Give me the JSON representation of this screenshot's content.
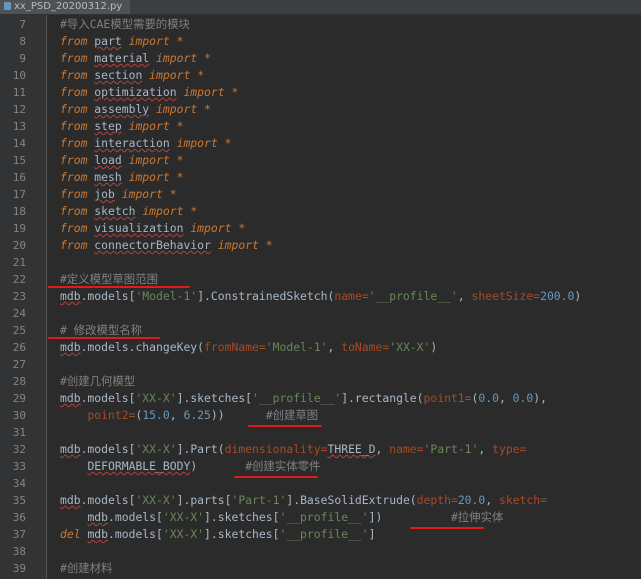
{
  "tab": {
    "filename": "xx_PSD_20200312.py"
  },
  "lines": [
    {
      "n": "7",
      "tokens": [
        {
          "t": "#导入CAE模型需要的模块",
          "c": "cmt"
        }
      ]
    },
    {
      "n": "8",
      "tokens": [
        {
          "t": "from",
          "c": "kw"
        },
        {
          "t": " "
        },
        {
          "t": "part",
          "c": "mod"
        },
        {
          "t": " "
        },
        {
          "t": "import",
          "c": "kw"
        },
        {
          "t": " "
        },
        {
          "t": "*",
          "c": "star"
        }
      ]
    },
    {
      "n": "9",
      "tokens": [
        {
          "t": "from",
          "c": "kw"
        },
        {
          "t": " "
        },
        {
          "t": "material",
          "c": "mod"
        },
        {
          "t": " "
        },
        {
          "t": "import",
          "c": "kw"
        },
        {
          "t": " "
        },
        {
          "t": "*",
          "c": "star"
        }
      ]
    },
    {
      "n": "10",
      "tokens": [
        {
          "t": "from",
          "c": "kw"
        },
        {
          "t": " "
        },
        {
          "t": "section",
          "c": "mod"
        },
        {
          "t": " "
        },
        {
          "t": "import",
          "c": "kw"
        },
        {
          "t": " "
        },
        {
          "t": "*",
          "c": "star"
        }
      ]
    },
    {
      "n": "11",
      "tokens": [
        {
          "t": "from",
          "c": "kw"
        },
        {
          "t": " "
        },
        {
          "t": "optimization",
          "c": "mod"
        },
        {
          "t": " "
        },
        {
          "t": "import",
          "c": "kw"
        },
        {
          "t": " "
        },
        {
          "t": "*",
          "c": "star"
        }
      ]
    },
    {
      "n": "12",
      "tokens": [
        {
          "t": "from",
          "c": "kw"
        },
        {
          "t": " "
        },
        {
          "t": "assembly",
          "c": "mod"
        },
        {
          "t": " "
        },
        {
          "t": "import",
          "c": "kw"
        },
        {
          "t": " "
        },
        {
          "t": "*",
          "c": "star"
        }
      ]
    },
    {
      "n": "13",
      "tokens": [
        {
          "t": "from",
          "c": "kw"
        },
        {
          "t": " "
        },
        {
          "t": "step",
          "c": "mod"
        },
        {
          "t": " "
        },
        {
          "t": "import",
          "c": "kw"
        },
        {
          "t": " "
        },
        {
          "t": "*",
          "c": "star"
        }
      ]
    },
    {
      "n": "14",
      "tokens": [
        {
          "t": "from",
          "c": "kw"
        },
        {
          "t": " "
        },
        {
          "t": "interaction",
          "c": "mod"
        },
        {
          "t": " "
        },
        {
          "t": "import",
          "c": "kw"
        },
        {
          "t": " "
        },
        {
          "t": "*",
          "c": "star"
        }
      ]
    },
    {
      "n": "15",
      "tokens": [
        {
          "t": "from",
          "c": "kw"
        },
        {
          "t": " "
        },
        {
          "t": "load",
          "c": "mod"
        },
        {
          "t": " "
        },
        {
          "t": "import",
          "c": "kw"
        },
        {
          "t": " "
        },
        {
          "t": "*",
          "c": "star"
        }
      ]
    },
    {
      "n": "16",
      "tokens": [
        {
          "t": "from",
          "c": "kw"
        },
        {
          "t": " "
        },
        {
          "t": "mesh",
          "c": "mod"
        },
        {
          "t": " "
        },
        {
          "t": "import",
          "c": "kw"
        },
        {
          "t": " "
        },
        {
          "t": "*",
          "c": "star"
        }
      ]
    },
    {
      "n": "17",
      "tokens": [
        {
          "t": "from",
          "c": "kw"
        },
        {
          "t": " "
        },
        {
          "t": "job",
          "c": "mod"
        },
        {
          "t": " "
        },
        {
          "t": "import",
          "c": "kw"
        },
        {
          "t": " "
        },
        {
          "t": "*",
          "c": "star"
        }
      ]
    },
    {
      "n": "18",
      "tokens": [
        {
          "t": "from",
          "c": "kw"
        },
        {
          "t": " "
        },
        {
          "t": "sketch",
          "c": "mod"
        },
        {
          "t": " "
        },
        {
          "t": "import",
          "c": "kw"
        },
        {
          "t": " "
        },
        {
          "t": "*",
          "c": "star"
        }
      ]
    },
    {
      "n": "19",
      "tokens": [
        {
          "t": "from",
          "c": "kw"
        },
        {
          "t": " "
        },
        {
          "t": "visualization",
          "c": "mod"
        },
        {
          "t": " "
        },
        {
          "t": "import",
          "c": "kw"
        },
        {
          "t": " "
        },
        {
          "t": "*",
          "c": "star"
        }
      ]
    },
    {
      "n": "20",
      "tokens": [
        {
          "t": "from",
          "c": "kw"
        },
        {
          "t": " "
        },
        {
          "t": "connectorBehavior",
          "c": "mod"
        },
        {
          "t": " "
        },
        {
          "t": "import",
          "c": "kw"
        },
        {
          "t": " "
        },
        {
          "t": "*",
          "c": "star"
        }
      ]
    },
    {
      "n": "21",
      "tokens": []
    },
    {
      "n": "22",
      "tokens": [
        {
          "t": "#定义模型草图范围",
          "c": "cmt"
        }
      ]
    },
    {
      "n": "23",
      "tokens": [
        {
          "t": "mdb",
          "c": "mod"
        },
        {
          "t": ".models[",
          "c": "ident"
        },
        {
          "t": "'Model-1'",
          "c": "str"
        },
        {
          "t": "].ConstrainedSketch(",
          "c": "func"
        },
        {
          "t": "name=",
          "c": "param"
        },
        {
          "t": "'__profile__'",
          "c": "str"
        },
        {
          "t": ", "
        },
        {
          "t": "sheetSize=",
          "c": "param"
        },
        {
          "t": "200.0",
          "c": "num"
        },
        {
          "t": ")"
        }
      ]
    },
    {
      "n": "24",
      "tokens": []
    },
    {
      "n": "25",
      "tokens": [
        {
          "t": "# 修改模型名称",
          "c": "cmt"
        }
      ]
    },
    {
      "n": "26",
      "tokens": [
        {
          "t": "mdb",
          "c": "mod"
        },
        {
          "t": ".models.changeKey(",
          "c": "func"
        },
        {
          "t": "fromName=",
          "c": "param"
        },
        {
          "t": "'Model-1'",
          "c": "str"
        },
        {
          "t": ", "
        },
        {
          "t": "toName=",
          "c": "param"
        },
        {
          "t": "'XX-X'",
          "c": "str"
        },
        {
          "t": ")"
        }
      ]
    },
    {
      "n": "27",
      "tokens": []
    },
    {
      "n": "28",
      "tokens": [
        {
          "t": "#创建几何模型",
          "c": "cmt"
        }
      ]
    },
    {
      "n": "29",
      "tokens": [
        {
          "t": "mdb",
          "c": "mod"
        },
        {
          "t": ".models[",
          "c": "ident"
        },
        {
          "t": "'XX-X'",
          "c": "str"
        },
        {
          "t": "].sketches[",
          "c": "ident"
        },
        {
          "t": "'__profile__'",
          "c": "str"
        },
        {
          "t": "].rectangle(",
          "c": "func"
        },
        {
          "t": "point1=",
          "c": "param"
        },
        {
          "t": "(",
          "c": "ident"
        },
        {
          "t": "0.0",
          "c": "num"
        },
        {
          "t": ", "
        },
        {
          "t": "0.0",
          "c": "num"
        },
        {
          "t": "),"
        }
      ]
    },
    {
      "n": "30",
      "tokens": [
        {
          "t": "    "
        },
        {
          "t": "point2=",
          "c": "param"
        },
        {
          "t": "(",
          "c": "ident"
        },
        {
          "t": "15.0",
          "c": "num"
        },
        {
          "t": ", "
        },
        {
          "t": "6.25",
          "c": "num"
        },
        {
          "t": "))"
        },
        {
          "t": "      "
        },
        {
          "t": "#创建草图",
          "c": "cmt"
        }
      ]
    },
    {
      "n": "31",
      "tokens": []
    },
    {
      "n": "32",
      "tokens": [
        {
          "t": "mdb",
          "c": "mod"
        },
        {
          "t": ".models[",
          "c": "ident"
        },
        {
          "t": "'XX-X'",
          "c": "str"
        },
        {
          "t": "].Part(",
          "c": "func"
        },
        {
          "t": "dimensionality=",
          "c": "param"
        },
        {
          "t": "THREE_D",
          "c": "mod"
        },
        {
          "t": ", "
        },
        {
          "t": "name=",
          "c": "param"
        },
        {
          "t": "'Part-1'",
          "c": "str"
        },
        {
          "t": ", "
        },
        {
          "t": "type=",
          "c": "param"
        }
      ]
    },
    {
      "n": "33",
      "tokens": [
        {
          "t": "    "
        },
        {
          "t": "DEFORMABLE_BODY",
          "c": "mod"
        },
        {
          "t": ")"
        },
        {
          "t": "       "
        },
        {
          "t": "#创建实体零件",
          "c": "cmt"
        }
      ]
    },
    {
      "n": "34",
      "tokens": []
    },
    {
      "n": "35",
      "tokens": [
        {
          "t": "mdb",
          "c": "mod"
        },
        {
          "t": ".models[",
          "c": "ident"
        },
        {
          "t": "'XX-X'",
          "c": "str"
        },
        {
          "t": "].parts[",
          "c": "ident"
        },
        {
          "t": "'Part-1'",
          "c": "str"
        },
        {
          "t": "].BaseSolidExtrude(",
          "c": "func"
        },
        {
          "t": "depth=",
          "c": "param"
        },
        {
          "t": "20.0",
          "c": "num"
        },
        {
          "t": ", "
        },
        {
          "t": "sketch=",
          "c": "param"
        }
      ]
    },
    {
      "n": "36",
      "tokens": [
        {
          "t": "    "
        },
        {
          "t": "mdb",
          "c": "mod"
        },
        {
          "t": ".models[",
          "c": "ident"
        },
        {
          "t": "'XX-X'",
          "c": "str"
        },
        {
          "t": "].sketches[",
          "c": "ident"
        },
        {
          "t": "'__profile__'",
          "c": "str"
        },
        {
          "t": "])"
        },
        {
          "t": "          "
        },
        {
          "t": "#拉伸实体",
          "c": "cmt"
        }
      ]
    },
    {
      "n": "37",
      "tokens": [
        {
          "t": "del",
          "c": "kw"
        },
        {
          "t": " "
        },
        {
          "t": "mdb",
          "c": "mod"
        },
        {
          "t": ".models[",
          "c": "ident"
        },
        {
          "t": "'XX-X'",
          "c": "str"
        },
        {
          "t": "].sketches[",
          "c": "ident"
        },
        {
          "t": "'__profile__'",
          "c": "str"
        },
        {
          "t": "]"
        }
      ]
    },
    {
      "n": "38",
      "tokens": []
    },
    {
      "n": "39",
      "tokens": [
        {
          "t": "#创建材料",
          "c": "cmt"
        }
      ]
    }
  ],
  "colors": {
    "background": "#2b2b2b",
    "keyword": "#cc7832",
    "string": "#6a8759",
    "number": "#6897bb",
    "parameter": "#aa4926",
    "comment": "#808080",
    "annotation_underline": "#e01b1b"
  }
}
